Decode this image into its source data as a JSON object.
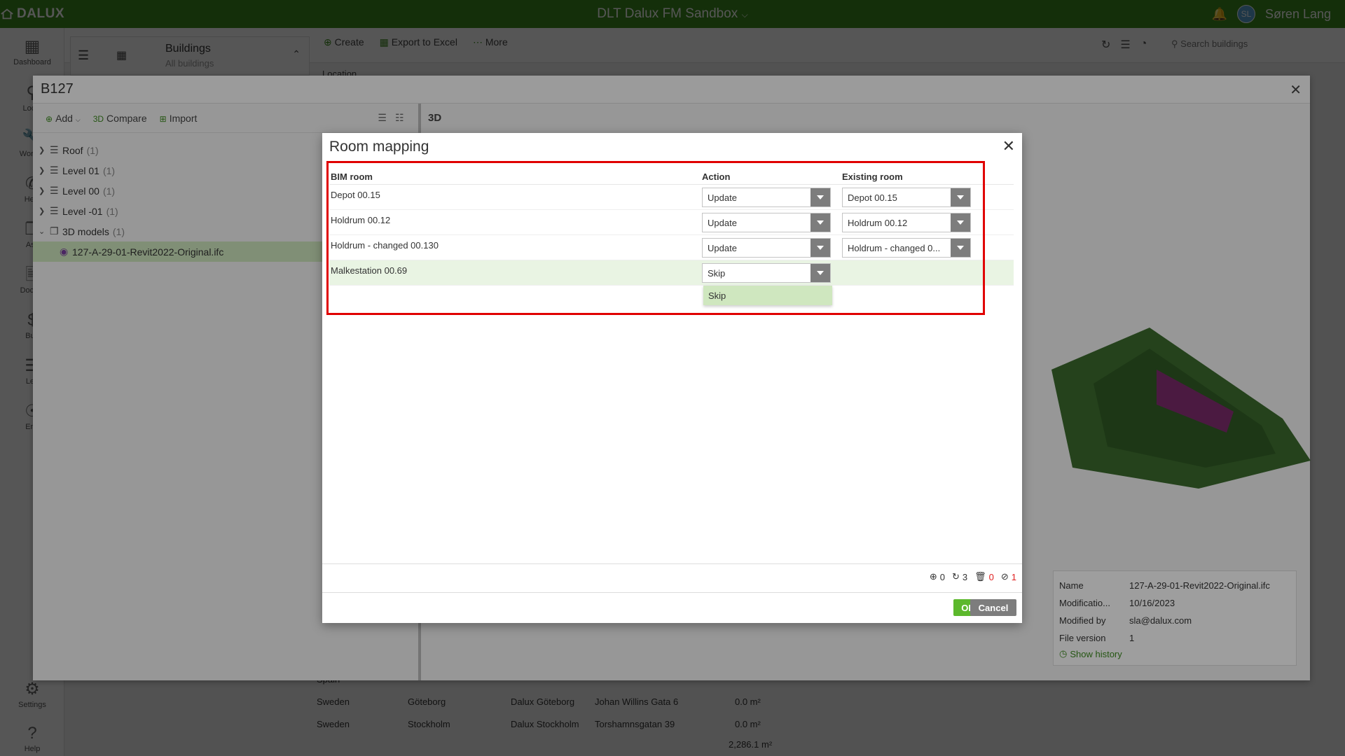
{
  "app": {
    "logo": "DALUX",
    "project": "DLT Dalux FM Sandbox",
    "user": "Søren Lang",
    "user_initials": "SL"
  },
  "nav": {
    "dashboard": "Dashboard",
    "locations": "Locat",
    "work": "Work C",
    "help_desk": "Help",
    "assets": "Ass",
    "documents": "Docum",
    "budget": "Bud",
    "lease": "Lea",
    "energy": "Ene",
    "settings": "Settings",
    "help": "Help"
  },
  "toolbar": {
    "buildings_title": "Buildings",
    "buildings_sub": "All buildings",
    "create": "Create",
    "export": "Export to Excel",
    "more": "More",
    "search_placeholder": "Search buildings",
    "location_col": "Location"
  },
  "bg_table": [
    {
      "country": "Spain",
      "city": "",
      "name": "",
      "address": "",
      "area": ""
    },
    {
      "country": "Sweden",
      "city": "Göteborg",
      "name": "Dalux Göteborg",
      "address": "Johan Willins Gata 6",
      "area": "0.0 m²"
    },
    {
      "country": "Sweden",
      "city": "Stockholm",
      "name": "Dalux Stockholm",
      "address": "Torshamnsgatan 39",
      "area": "0.0 m²"
    }
  ],
  "bg_total": "2,286.1 m²",
  "b127": {
    "title": "B127",
    "tools": {
      "add": "Add",
      "compare": "Compare",
      "import": "Import",
      "compare_badge": "3D"
    },
    "tree": [
      {
        "label": "Roof",
        "count": "(1)"
      },
      {
        "label": "Level 01",
        "count": "(1)"
      },
      {
        "label": "Level 00",
        "count": "(1)"
      },
      {
        "label": "Level -01",
        "count": "(1)"
      },
      {
        "label": "3D models",
        "count": "(1)"
      },
      {
        "label": "127-A-29-01-Revit2022-Original.ifc",
        "count": ""
      }
    ],
    "viewer_badge": "3D",
    "props": {
      "name_k": "Name",
      "name_v": "127-A-29-01-Revit2022-Original.ifc",
      "mod_k": "Modificatio...",
      "mod_v": "10/16/2023",
      "by_k": "Modified by",
      "by_v": "sla@dalux.com",
      "ver_k": "File version",
      "ver_v": "1",
      "history": "Show history"
    }
  },
  "modal": {
    "title": "Room mapping",
    "headers": {
      "bim": "BIM room",
      "action": "Action",
      "existing": "Existing room"
    },
    "rows": [
      {
        "bim": "Depot 00.15",
        "action": "Update",
        "existing": "Depot 00.15"
      },
      {
        "bim": "Holdrum 00.12",
        "action": "Update",
        "existing": "Holdrum 00.12"
      },
      {
        "bim": "Holdrum - changed 00.130",
        "action": "Update",
        "existing": "Holdrum - changed 0..."
      },
      {
        "bim": "Malkestation 00.69",
        "action": "Skip",
        "existing": ""
      }
    ],
    "dropdown_option": "Skip",
    "counters": {
      "added": "0",
      "updated": "3",
      "deleted": "0",
      "skipped": "1"
    },
    "ok": "OK",
    "cancel": "Cancel"
  },
  "colors": {
    "brand": "#3d8b1f",
    "ok": "#5cb82c",
    "highlight": "#e00000"
  }
}
